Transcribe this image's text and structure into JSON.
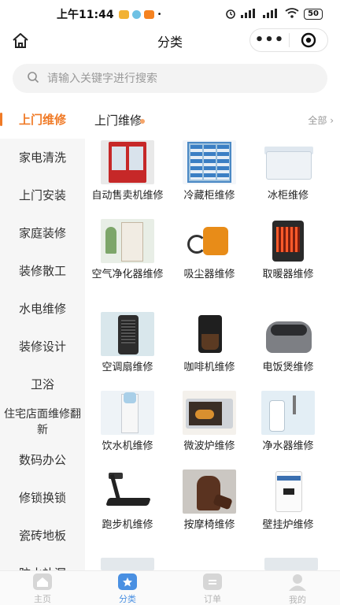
{
  "status_bar": {
    "time": "上午11:44",
    "signal": "HD",
    "battery": "50",
    "colors": {
      "app1": "#f2b233",
      "app2": "#6ec1e4",
      "app3": "#f58220"
    }
  },
  "nav": {
    "title": "分类",
    "more_label": "•••"
  },
  "search": {
    "placeholder": "请输入关键字进行搜索"
  },
  "sidebar": {
    "items": [
      {
        "label": "上门维修",
        "active": true
      },
      {
        "label": "家电清洗"
      },
      {
        "label": "上门安装"
      },
      {
        "label": "家庭装修"
      },
      {
        "label": "装修散工"
      },
      {
        "label": "水电维修"
      },
      {
        "label": "装修设计"
      },
      {
        "label": "卫浴"
      },
      {
        "label": "住宅店面维修翻新"
      },
      {
        "label": "数码办公"
      },
      {
        "label": "修锁换锁"
      },
      {
        "label": "瓷砖地板"
      },
      {
        "label": "防水补漏"
      }
    ],
    "accent_color": "#f07a26"
  },
  "main": {
    "section_title": "上门维修",
    "view_all": "全部",
    "products": [
      {
        "label": "自动售卖机维修",
        "icon": "vending-machine"
      },
      {
        "label": "冷藏柜维修",
        "icon": "refrigerated-cabinet"
      },
      {
        "label": "冰柜维修",
        "icon": "freezer"
      },
      {
        "label": "空气净化器维修",
        "icon": "air-purifier"
      },
      {
        "label": "吸尘器维修",
        "icon": "vacuum-cleaner"
      },
      {
        "label": "取暖器维修",
        "icon": "heater"
      },
      {
        "label": "空调扇维修",
        "icon": "air-cooler-fan"
      },
      {
        "label": "咖啡机维修",
        "icon": "coffee-machine"
      },
      {
        "label": "电饭煲维修",
        "icon": "rice-cooker"
      },
      {
        "label": "饮水机维修",
        "icon": "water-dispenser"
      },
      {
        "label": "微波炉维修",
        "icon": "microwave"
      },
      {
        "label": "净水器维修",
        "icon": "water-purifier"
      },
      {
        "label": "跑步机维修",
        "icon": "treadmill"
      },
      {
        "label": "按摩椅维修",
        "icon": "massage-chair"
      },
      {
        "label": "壁挂炉维修",
        "icon": "wall-boiler"
      }
    ]
  },
  "tab_bar": {
    "tabs": [
      {
        "label": "主页",
        "icon": "home-icon"
      },
      {
        "label": "分类",
        "icon": "category-icon",
        "active": true
      },
      {
        "label": "订单",
        "icon": "order-icon"
      },
      {
        "label": "我的",
        "icon": "profile-icon"
      }
    ],
    "active_color": "#4a90e2"
  }
}
